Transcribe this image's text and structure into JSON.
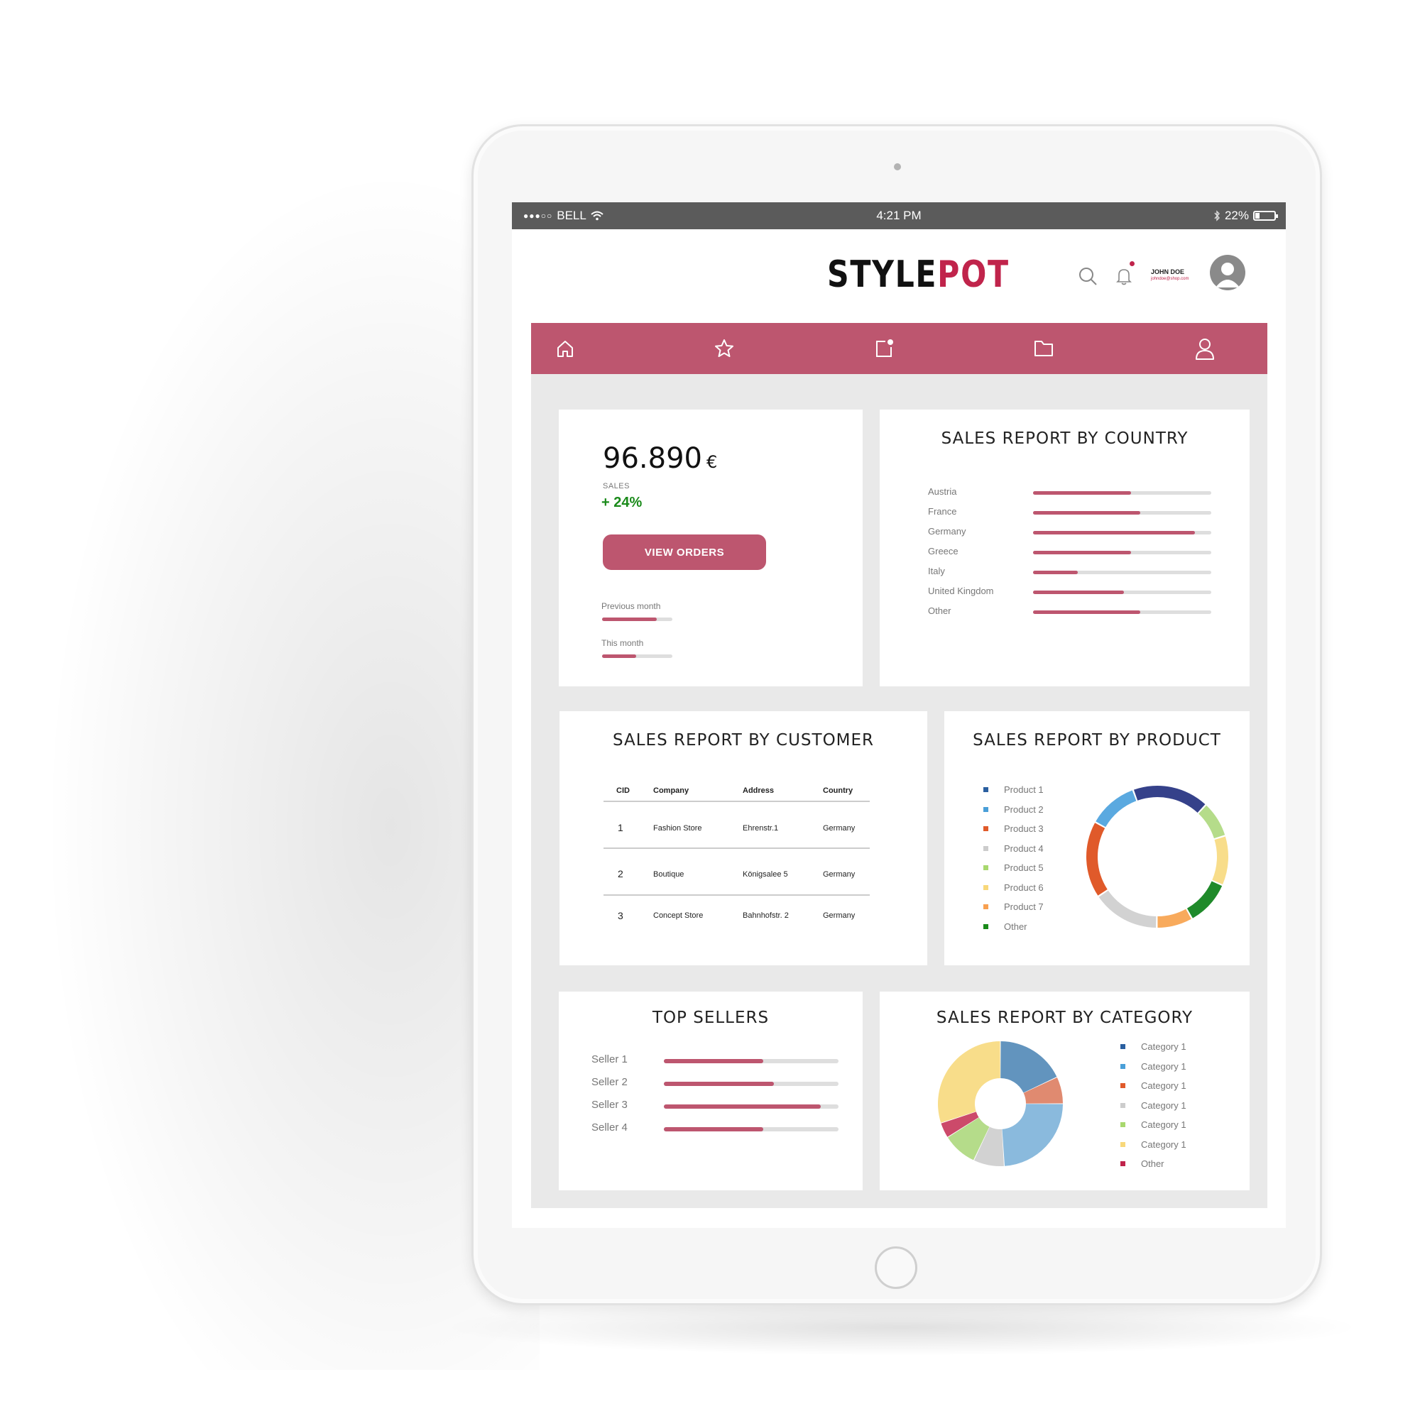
{
  "statusbar": {
    "carrier": "BELL",
    "time": "4:21 PM",
    "battery": "22%"
  },
  "header": {
    "logo_part1": "STYLE",
    "logo_part2": "POT",
    "user_name": "JOHN DOE",
    "user_email": "johndoe@shop.com"
  },
  "icons": {
    "search": "search-icon",
    "bell": "bell-icon",
    "avatar": "avatar-icon",
    "nav": [
      "home-icon",
      "star-icon",
      "notes-icon",
      "folder-icon",
      "user-icon"
    ]
  },
  "colors": {
    "accent": "#bd566f",
    "logo_red": "#c0244b",
    "growth_green": "#1a8a1a",
    "status_bar": "#5b5b5b",
    "content_bg": "#e9e9e9"
  },
  "sales": {
    "amount": "96.890",
    "currency": "€",
    "label": "SALES",
    "growth": "+ 24%",
    "button": "VIEW ORDERS",
    "previous_label": "Previous month",
    "previous_fraction": 0.78,
    "this_label": "This month",
    "this_fraction": 0.48
  },
  "country_report": {
    "title": "SALES REPORT BY COUNTRY",
    "rows": [
      {
        "label": "Austria",
        "fraction": 0.55
      },
      {
        "label": "France",
        "fraction": 0.6
      },
      {
        "label": "Germany",
        "fraction": 0.91
      },
      {
        "label": "Greece",
        "fraction": 0.55
      },
      {
        "label": "Italy",
        "fraction": 0.25
      },
      {
        "label": "United Kingdom",
        "fraction": 0.51
      },
      {
        "label": "Other",
        "fraction": 0.6
      }
    ]
  },
  "customer_report": {
    "title": "SALES REPORT BY CUSTOMER",
    "columns": [
      "CID",
      "Company",
      "Address",
      "Country"
    ],
    "rows": [
      [
        "1",
        "Fashion Store",
        "Ehrenstr.1",
        "Germany"
      ],
      [
        "2",
        "Boutique",
        "Königsalee 5",
        "Germany"
      ],
      [
        "3",
        "Concept Store",
        "Bahnhofstr. 2",
        "Germany"
      ]
    ]
  },
  "product_report": {
    "title": "SALES REPORT BY PRODUCT",
    "legend": [
      {
        "label": "Product 1",
        "color": "#2a5fa0"
      },
      {
        "label": "Product 2",
        "color": "#4a9fd8"
      },
      {
        "label": "Product 3",
        "color": "#e05a2a"
      },
      {
        "label": "Product 4",
        "color": "#cccccc"
      },
      {
        "label": "Product 5",
        "color": "#a8d86e"
      },
      {
        "label": "Product 6",
        "color": "#f8d87a"
      },
      {
        "label": "Product 7",
        "color": "#f8a050"
      },
      {
        "label": "Other",
        "color": "#1a8a1a"
      }
    ]
  },
  "top_sellers": {
    "title": "TOP SELLERS",
    "rows": [
      {
        "label": "Seller 1",
        "fraction": 0.57
      },
      {
        "label": "Seller 2",
        "fraction": 0.63
      },
      {
        "label": "Seller 3",
        "fraction": 0.9
      },
      {
        "label": "Seller 4",
        "fraction": 0.57
      }
    ]
  },
  "category_report": {
    "title": "SALES REPORT BY CATEGORY",
    "legend": [
      {
        "label": "Category 1",
        "color": "#2a5fa0"
      },
      {
        "label": "Category 1",
        "color": "#4a9fd8"
      },
      {
        "label": "Category 1",
        "color": "#e05a2a"
      },
      {
        "label": "Category 1",
        "color": "#cccccc"
      },
      {
        "label": "Category 1",
        "color": "#a8d86e"
      },
      {
        "label": "Category 1",
        "color": "#f8d87a"
      },
      {
        "label": "Other",
        "color": "#c0244b"
      }
    ]
  },
  "chart_data": [
    {
      "type": "pie",
      "name_hint": "product donut",
      "categories": [
        "Product 1",
        "Product 2",
        "Product 3",
        "Product 4",
        "Product 5",
        "Product 6",
        "Product 7",
        "Other"
      ],
      "values": [
        17,
        8,
        11,
        10,
        8,
        15,
        17,
        11
      ],
      "colors": [
        "#35418a",
        "#b5dc8a",
        "#f8dd8a",
        "#1f8a2a",
        "#f8aa5c",
        "#d2d2d2",
        "#e05a2a",
        "#5aa9e0"
      ]
    },
    {
      "type": "pie",
      "name_hint": "category donut",
      "categories": [
        "Category 1",
        "Category 1",
        "Category 1",
        "Category 1",
        "Category 1",
        "Category 1",
        "Other"
      ],
      "values": [
        18,
        7,
        24,
        8,
        9,
        4,
        30
      ],
      "colors": [
        "#6294be",
        "#e08a70",
        "#8abadd",
        "#d2d2d2",
        "#b5dc8a",
        "#cc4a6a",
        "#f8dd8a"
      ]
    }
  ]
}
